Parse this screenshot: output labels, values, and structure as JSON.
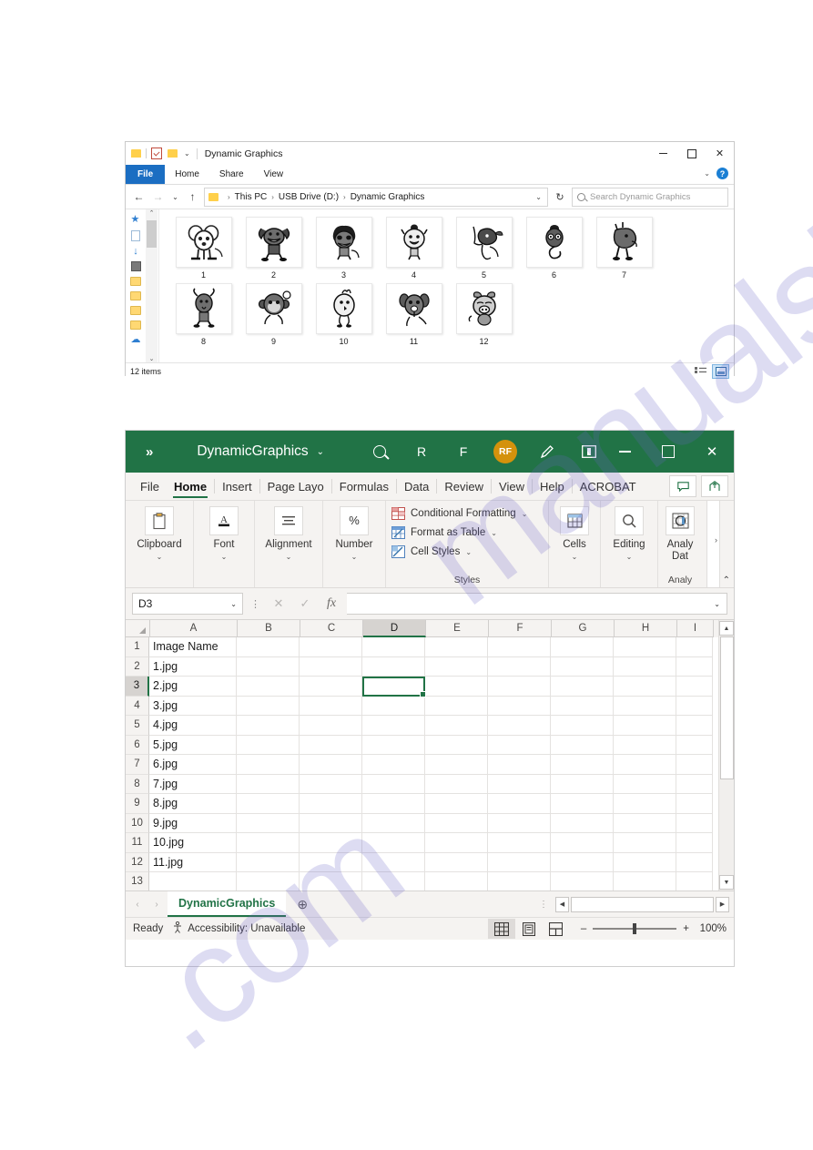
{
  "explorer": {
    "title": "Dynamic Graphics",
    "quick_access": {
      "folder_icon": "folder-icon",
      "properties_icon": "properties-icon",
      "new_folder_icon": "new-folder-icon",
      "customize_caret": "⌄"
    },
    "window_controls": {
      "minimize": "–",
      "maximize": "☐",
      "close": "✕",
      "ribbon_caret": "⌄",
      "help": "?"
    },
    "tabs": [
      {
        "label": "File"
      },
      {
        "label": "Home"
      },
      {
        "label": "Share"
      },
      {
        "label": "View"
      }
    ],
    "address": {
      "back": "←",
      "forward": "→",
      "recent_caret": "⌄",
      "up": "↑",
      "breadcrumb": [
        "This PC",
        "USB Drive (D:)",
        "Dynamic Graphics"
      ],
      "separator": "›",
      "dropdown_caret": "⌄",
      "refresh": "↻"
    },
    "search": {
      "placeholder": "Search Dynamic Graphics",
      "icon": "search-icon"
    },
    "sidebar": {
      "icons": [
        "pin-icon",
        "document-icon",
        "downloads-icon",
        "pictures-icon",
        "folder-icon",
        "folder-icon",
        "folder-icon",
        "folder-icon",
        "onedrive-cloud-icon"
      ],
      "scroll_up": "⌃",
      "scroll_down": "⌄"
    },
    "files": [
      {
        "label": "1",
        "creature": "rat"
      },
      {
        "label": "2",
        "creature": "ox"
      },
      {
        "label": "3",
        "creature": "tiger"
      },
      {
        "label": "4",
        "creature": "rabbit"
      },
      {
        "label": "5",
        "creature": "dragon"
      },
      {
        "label": "6",
        "creature": "snake"
      },
      {
        "label": "7",
        "creature": "horse"
      },
      {
        "label": "8",
        "creature": "goat"
      },
      {
        "label": "9",
        "creature": "monkey"
      },
      {
        "label": "10",
        "creature": "rooster"
      },
      {
        "label": "11",
        "creature": "dog"
      },
      {
        "label": "12",
        "creature": "pig"
      }
    ],
    "status": {
      "item_count": "12 items",
      "view_details_icon": "details-view-icon",
      "view_large_icons_icon": "large-icons-view-icon"
    }
  },
  "excel": {
    "titlebar": {
      "chevrons": "»",
      "document_name": "DynamicGraphics",
      "name_caret": "⌄",
      "search_icon": "search-icon",
      "initial_r": "R",
      "initial_f": "F",
      "avatar_initials": "RF",
      "pen_icon": "pen-icon",
      "present_icon": "present-icon",
      "minimize": "–",
      "maximize": "☐",
      "close": "✕"
    },
    "ribbon_tabs": [
      {
        "label": "File",
        "active": false
      },
      {
        "label": "Home",
        "active": true
      },
      {
        "label": "Insert",
        "active": false
      },
      {
        "label": "Page Layo",
        "active": false
      },
      {
        "label": "Formulas",
        "active": false
      },
      {
        "label": "Data",
        "active": false
      },
      {
        "label": "Review",
        "active": false
      },
      {
        "label": "View",
        "active": false
      },
      {
        "label": "Help",
        "active": false
      },
      {
        "label": "ACROBAT",
        "active": false
      }
    ],
    "ribbon_right_buttons": [
      {
        "name": "comments-button",
        "glyph": "⬜"
      },
      {
        "name": "share-button",
        "glyph": "↱"
      }
    ],
    "ribbon_groups": {
      "clipboard": {
        "label": "Clipboard",
        "icon": "clipboard-icon",
        "caret": "⌄"
      },
      "font": {
        "label": "Font",
        "icon": "font-icon",
        "caret": "⌄"
      },
      "alignment": {
        "label": "Alignment",
        "icon": "alignment-icon",
        "caret": "⌄"
      },
      "number": {
        "label": "Number",
        "icon": "percent-icon",
        "caret": "⌄"
      },
      "styles": {
        "title": "Styles",
        "items": [
          {
            "label": "Conditional Formatting",
            "icon": "conditional-formatting-icon",
            "caret": "⌄"
          },
          {
            "label": "Format as Table",
            "icon": "format-as-table-icon",
            "caret": "⌄"
          },
          {
            "label": "Cell Styles",
            "icon": "cell-styles-icon",
            "caret": "⌄"
          }
        ]
      },
      "cells": {
        "label": "Cells",
        "icon": "cells-icon",
        "caret": "⌄"
      },
      "editing": {
        "label": "Editing",
        "icon": "editing-search-icon",
        "caret": "⌄"
      },
      "analyze": {
        "label_line1": "Analy",
        "label_line2": "Dat",
        "title": "Analy",
        "icon": "analyze-data-icon",
        "overflow": "›"
      },
      "collapse_caret": "⌃"
    },
    "formula_bar": {
      "name_box_value": "D3",
      "name_box_caret": "⌄",
      "cancel_icon": "✕",
      "confirm_icon": "✓",
      "function_icon": "fx",
      "formula_value": "",
      "expand_caret": "⌄"
    },
    "grid": {
      "columns": [
        "A",
        "B",
        "C",
        "D",
        "E",
        "F",
        "G",
        "H",
        "I"
      ],
      "selected_column": "D",
      "selected_row": 3,
      "selected_cell": "D3",
      "rows": [
        {
          "num": "1",
          "a": "Image Name"
        },
        {
          "num": "2",
          "a": "1.jpg"
        },
        {
          "num": "3",
          "a": "2.jpg"
        },
        {
          "num": "4",
          "a": "3.jpg"
        },
        {
          "num": "5",
          "a": "4.jpg"
        },
        {
          "num": "6",
          "a": "5.jpg"
        },
        {
          "num": "7",
          "a": "6.jpg"
        },
        {
          "num": "8",
          "a": "7.jpg"
        },
        {
          "num": "9",
          "a": "8.jpg"
        },
        {
          "num": "10",
          "a": "9.jpg"
        },
        {
          "num": "11",
          "a": "10.jpg"
        },
        {
          "num": "12",
          "a": "11.jpg"
        },
        {
          "num": "13",
          "a": ""
        }
      ],
      "scroll_up": "▲",
      "scroll_down": "▼"
    },
    "sheet_bar": {
      "prev": "‹",
      "next": "›",
      "tab_name": "DynamicGraphics",
      "add_sheet": "⊕",
      "dots": "⋮",
      "hscroll_left": "◀",
      "hscroll_right": "▶"
    },
    "status_bar": {
      "state": "Ready",
      "accessibility": "Accessibility: Unavailable",
      "accessibility_icon": "accessibility-icon",
      "views": [
        {
          "name": "normal-view-button",
          "icon": "grid-icon",
          "selected": true
        },
        {
          "name": "page-layout-view-button",
          "icon": "page-layout-icon",
          "selected": false
        },
        {
          "name": "page-break-view-button",
          "icon": "page-break-icon",
          "selected": false
        }
      ],
      "zoom_out": "–",
      "zoom_in": "+",
      "zoom_level": "100%"
    }
  },
  "watermark": {
    "line1": "manualslib",
    "line2": ".com"
  }
}
